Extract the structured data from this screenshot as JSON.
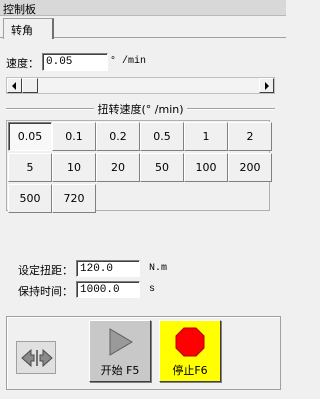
{
  "window": {
    "title": "控制板"
  },
  "tabs": [
    {
      "label": "转角",
      "active": true
    }
  ],
  "speed": {
    "label": "速度：",
    "value": "0.05",
    "unit": "° /min"
  },
  "rate_group": {
    "title": "扭转速度(° /min)",
    "buttons": [
      {
        "label": "0.05",
        "selected": true
      },
      {
        "label": "0.1"
      },
      {
        "label": "0.2"
      },
      {
        "label": "0.5"
      },
      {
        "label": "1"
      },
      {
        "label": "2"
      },
      {
        "label": "5"
      },
      {
        "label": "10"
      },
      {
        "label": "20"
      },
      {
        "label": "50"
      },
      {
        "label": "100"
      },
      {
        "label": "200"
      },
      {
        "label": "500"
      },
      {
        "label": "720"
      }
    ]
  },
  "torque": {
    "label": "设定扭距：",
    "value": "120.0",
    "unit": "N.m"
  },
  "hold_time": {
    "label": "保持时间：",
    "value": "1000.0",
    "unit": "s"
  },
  "controls": {
    "swap_icon": "swap-direction-icon",
    "start": {
      "label": "开始 F5",
      "icon": "play-icon"
    },
    "stop": {
      "label": "停止F6",
      "icon": "stop-icon",
      "color": "#ffff00",
      "icon_color": "#ff0000"
    }
  }
}
